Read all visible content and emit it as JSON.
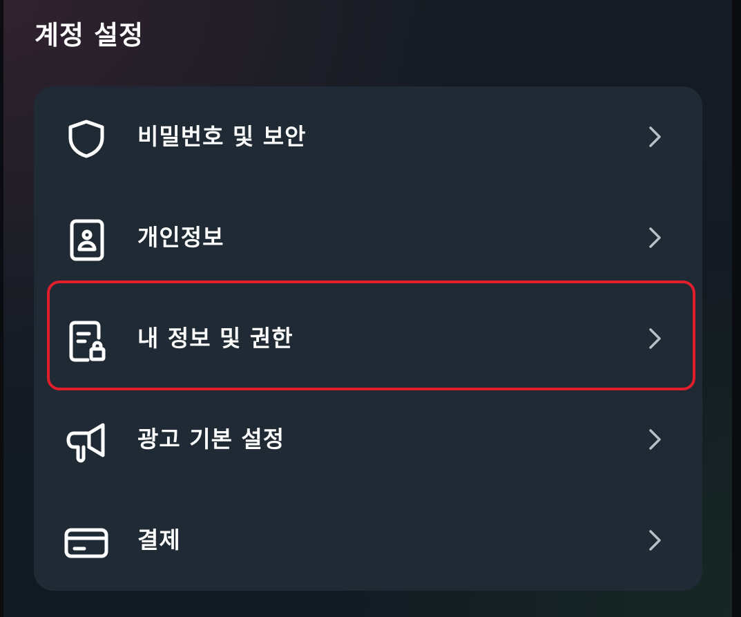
{
  "page": {
    "title": "계정 설정"
  },
  "menu": {
    "items": [
      {
        "label": "비밀번호 및 보안",
        "icon": "shield-icon"
      },
      {
        "label": "개인정보",
        "icon": "id-card-icon"
      },
      {
        "label": "내 정보 및 권한",
        "icon": "document-lock-icon"
      },
      {
        "label": "광고 기본 설정",
        "icon": "megaphone-icon"
      },
      {
        "label": "결제",
        "icon": "credit-card-icon"
      }
    ],
    "chevron_icon": "chevron-right-icon",
    "highlighted_index": 2
  },
  "colors": {
    "background": "#131a22",
    "card": "#1f2a34",
    "text": "#ffffff",
    "chevron": "#b9c0c7",
    "highlight": "#e01e2c"
  }
}
